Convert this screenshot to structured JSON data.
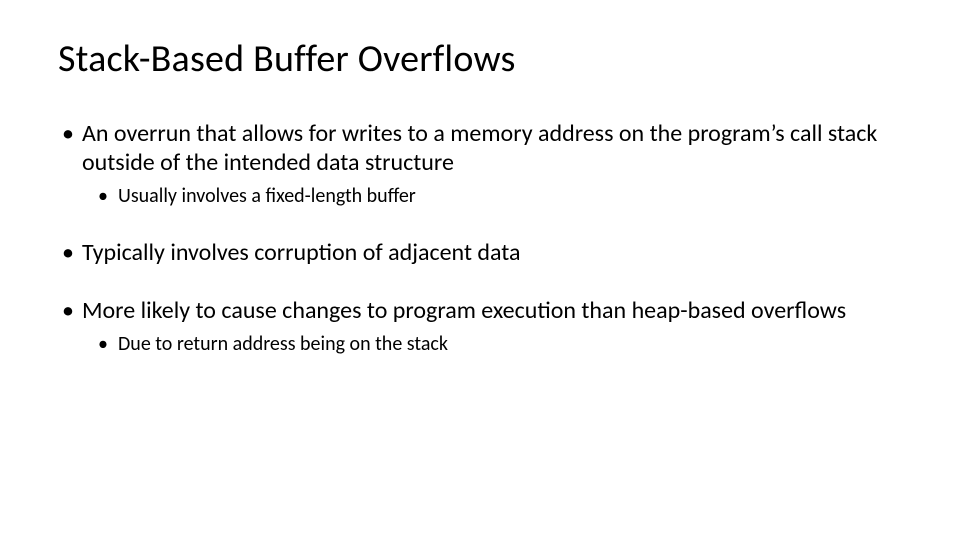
{
  "title": "Stack-Based Buffer Overflows",
  "bullets": [
    {
      "text": "An overrun that allows for writes to a memory address on the program’s call stack outside of the intended data structure",
      "sub": [
        "Usually involves a fixed-length buffer"
      ]
    },
    {
      "text": "Typically involves corruption of adjacent data",
      "sub": []
    },
    {
      "text": "More likely to cause changes to program execution than heap-based overflows",
      "sub": [
        "Due to return address being on the stack"
      ]
    }
  ]
}
